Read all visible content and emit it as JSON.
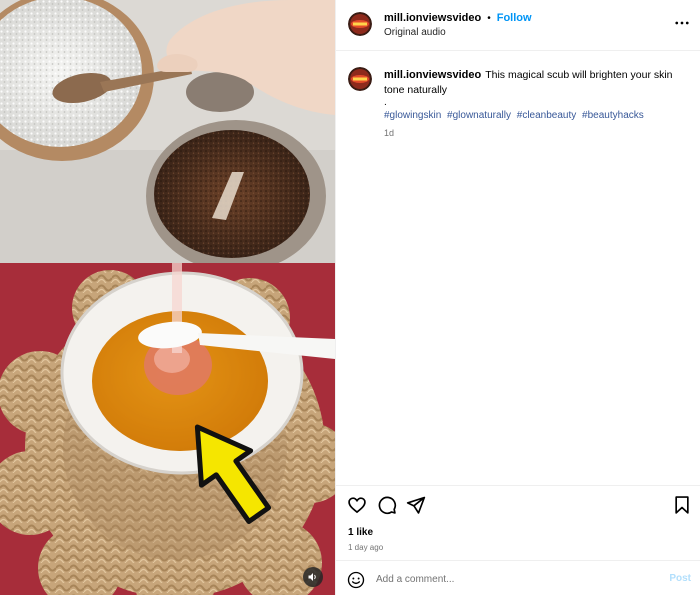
{
  "post": {
    "username": "mill.ionviewsvideo",
    "follow_label": "Follow",
    "dot": "•",
    "audio": "Original audio",
    "caption": "This magical scub will brighten your skin tone naturally",
    "caption_dot": ".",
    "hashtags": [
      "#glowingskin",
      "#glownaturally",
      "#cleanbeauty",
      "#beautyhacks"
    ],
    "caption_time": "1d"
  },
  "actions": {
    "likes": "1 like",
    "date": "1 day ago"
  },
  "comment": {
    "placeholder": "Add a comment...",
    "post_label": "Post"
  },
  "colors": {
    "follow": "#0095f6",
    "hashtag": "#385898",
    "post_disabled": "#b2dffc",
    "arrow": "#f5e600"
  },
  "icons": [
    "more-options-icon",
    "heart-icon",
    "comment-icon",
    "share-icon",
    "bookmark-icon",
    "emoji-icon",
    "volume-icon",
    "avatar-logo"
  ]
}
